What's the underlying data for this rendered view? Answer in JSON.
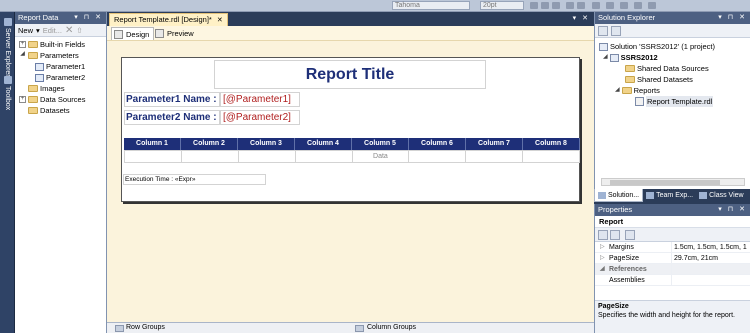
{
  "toolbar": {
    "font_name": "Tahoma",
    "font_size": "20pt"
  },
  "left_strip": {
    "server_explorer": "Server Explorer",
    "toolbox": "Toolbox"
  },
  "report_data": {
    "title": "Report Data",
    "new_label": "New",
    "edit_label": "Edit...",
    "tree": [
      {
        "label": "Built-in Fields",
        "expanded": false
      },
      {
        "label": "Parameters",
        "expanded": true
      },
      {
        "label": "Parameter1",
        "child": true
      },
      {
        "label": "Parameter2",
        "child": true
      },
      {
        "label": "Images",
        "expanded": null
      },
      {
        "label": "Data Sources",
        "expanded": false
      },
      {
        "label": "Datasets",
        "expanded": null
      }
    ]
  },
  "document": {
    "tab_label": "Report Template.rdl [Design]*",
    "design_tab": "Design",
    "preview_tab": "Preview",
    "report": {
      "title": "Report Title",
      "param1_label": "Parameter1 Name :",
      "param1_value": "[@Parameter1]",
      "param2_label": "Parameter2 Name :",
      "param2_value": "[@Parameter2]",
      "columns": [
        "Column 1",
        "Column 2",
        "Column 3",
        "Column 4",
        "Column 5",
        "Column 6",
        "Column 7",
        "Column 8"
      ],
      "data_cells": [
        "",
        "",
        "",
        "",
        "Data",
        "",
        "",
        ""
      ],
      "execution_time": "Execution Time :  «Expr»"
    },
    "row_groups": "Row Groups",
    "column_groups": "Column Groups"
  },
  "solution_explorer": {
    "title": "Solution Explorer",
    "solution": "Solution 'SSRS2012' (1 project)",
    "project": "SSRS2012",
    "shared_data_sources": "Shared Data Sources",
    "shared_datasets": "Shared Datasets",
    "reports": "Reports",
    "report_file": "Report Template.rdl",
    "tabs": [
      "Solution...",
      "Team Exp...",
      "Class View"
    ]
  },
  "properties": {
    "title": "Properties",
    "object": "Report",
    "rows": [
      {
        "key": "Margins",
        "value": "1.5cm, 1.5cm, 1.5cm, 1",
        "category": false
      },
      {
        "key": "PageSize",
        "value": "29.7cm, 21cm",
        "category": false
      },
      {
        "key": "References",
        "value": "",
        "category": true
      },
      {
        "key": "Assemblies",
        "value": "",
        "category": false
      }
    ],
    "desc_title": "PageSize",
    "desc_text": "Specifies the width and height for the report."
  },
  "colors": {
    "accent": "#1e2f78",
    "param_value": "#b01e1e",
    "chrome": "#2b3c59",
    "canvas": "#fbf3dc"
  }
}
